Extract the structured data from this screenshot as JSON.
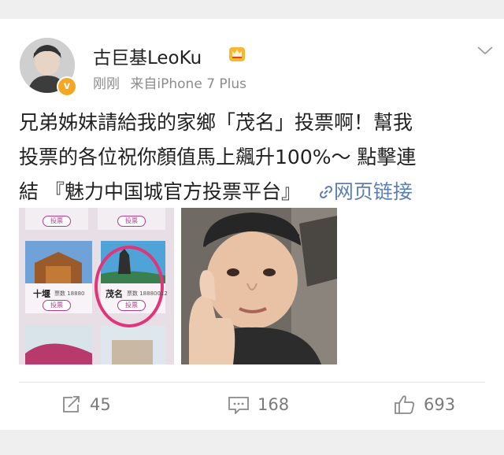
{
  "post": {
    "username": "古巨基LeoKu",
    "time": "刚刚",
    "source": "来自iPhone 7 Plus",
    "verified_badge": "v",
    "text_line1": "兄弟姊妹請給我的家鄉「茂名」投票啊！幫我",
    "text_line2": "投票的各位祝你顏值馬上飆升100%～ 點擊連",
    "text_line3": "結 『魅力中国城官方投票平台』",
    "link_icon": "🔗",
    "link_label": "网页链接",
    "icons": {
      "avatar": "avatar",
      "crown": "crown-icon",
      "menu": "chevron-down-icon"
    }
  },
  "image1": {
    "city_left": "十堰",
    "city_right": "茂名",
    "vote_label": "投票",
    "count_left": "票数 18880",
    "count_right": "票数 18880012",
    "highlight_color": "#e0357a"
  },
  "actions": {
    "repost_count": "45",
    "comment_count": "168",
    "like_count": "693"
  },
  "colors": {
    "link": "#5b7fb5",
    "meta": "#8c8c8c",
    "background": "#efefef"
  }
}
